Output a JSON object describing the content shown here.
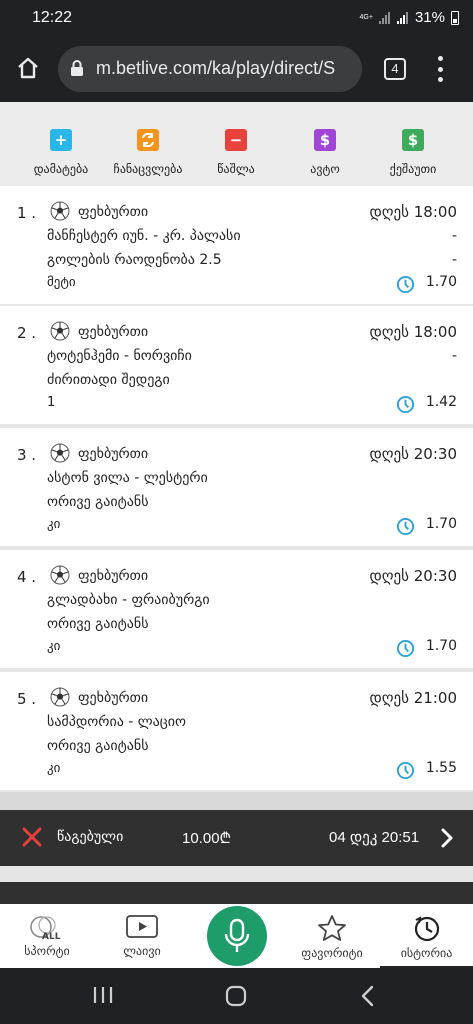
{
  "status_bar": {
    "time": "12:22",
    "network": "4G+",
    "battery": "31%"
  },
  "browser": {
    "url": "m.betlive.com/ka/play/direct/S",
    "tab_count": "4"
  },
  "toolbar": {
    "items": [
      {
        "label": "დამატება",
        "icon": "plus-icon",
        "color": "#29b6e8"
      },
      {
        "label": "ჩანაცვლება",
        "icon": "swap-icon",
        "color": "#f7941d"
      },
      {
        "label": "წაშლა",
        "icon": "minus-icon",
        "color": "#e8413c"
      },
      {
        "label": "ავტო",
        "icon": "dollar-icon",
        "color": "#a046d6"
      },
      {
        "label": "ქეშაუთი",
        "icon": "dollar-icon",
        "color": "#3daa5c"
      }
    ]
  },
  "bets": [
    {
      "num": "1 .",
      "sport": "ფეხბურთი",
      "when": "დღეს 18:00",
      "match": "მანჩესტერ იუნ. - კრ. პალასი",
      "market": "გოლების რაოდენობა 2.5",
      "pick": "მეტი",
      "odds": "1.70",
      "dash": "-"
    },
    {
      "num": "2 .",
      "sport": "ფეხბურთი",
      "when": "დღეს 18:00",
      "match": "ტოტენჰემი - ნორვიჩი",
      "market": "ძირითადი შედეგი",
      "pick": "1",
      "odds": "1.42",
      "dash": "-"
    },
    {
      "num": "3 .",
      "sport": "ფეხბურთი",
      "when": "დღეს 20:30",
      "match": "ასტონ ვილა - ლესტერი",
      "market": "ორივე გაიტანს",
      "pick": "კი",
      "odds": "1.70",
      "dash": "-"
    },
    {
      "num": "4 .",
      "sport": "ფეხბურთი",
      "when": "დღეს 20:30",
      "match": "გლადბახი - ფრაიბურგი",
      "market": "ორივე გაიტანს",
      "pick": "კი",
      "odds": "1.70",
      "dash": "-"
    },
    {
      "num": "5 .",
      "sport": "ფეხბურთი",
      "when": "დღეს 21:00",
      "match": "სამპდორია - ლაციო",
      "market": "ორივე გაიტანს",
      "pick": "კი",
      "odds": "1.55",
      "dash": "-"
    }
  ],
  "history": {
    "status": "წაგებული",
    "amount": "10.00₾",
    "date": "04 დეკ 20:51",
    "status_color": "#e8413c"
  },
  "bottom_nav": {
    "sports": "სპორტი",
    "sports_badge": "ALL",
    "live": "ლაივი",
    "favorites": "ფავორიტი",
    "history": "ისტორია"
  },
  "colors": {
    "accent": "#1e9c6a",
    "clock": "#29a3d6"
  }
}
